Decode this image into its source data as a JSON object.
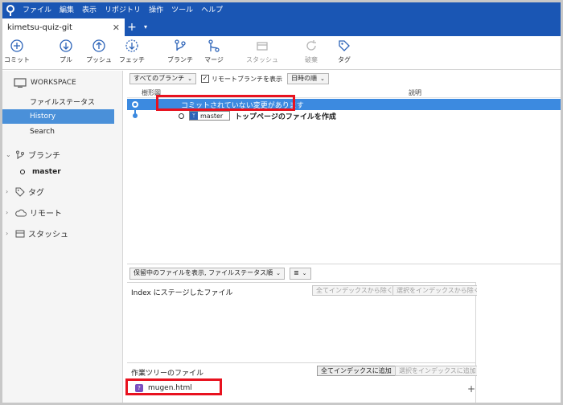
{
  "menu": [
    "ファイル",
    "編集",
    "表示",
    "リポジトリ",
    "操作",
    "ツール",
    "ヘルプ"
  ],
  "tab": {
    "title": "kimetsu-quiz-git",
    "close": "✕",
    "add": "+",
    "menu": "▾"
  },
  "toolbar": {
    "commit": "コミット",
    "pull": "プル",
    "push": "プッシュ",
    "fetch": "フェッチ",
    "branch": "ブランチ",
    "merge": "マージ",
    "stash": "スタッシュ",
    "discard": "破棄",
    "tag": "タグ"
  },
  "sidebar": {
    "workspace": "WORKSPACE",
    "items": [
      "ファイルステータス",
      "History",
      "Search"
    ],
    "selected_index": 1,
    "branches_label": "ブランチ",
    "branch_current": "master",
    "tags_label": "タグ",
    "remotes_label": "リモート",
    "stashes_label": "スタッシュ"
  },
  "filters": {
    "branches": "すべてのブランチ",
    "remote_checkbox_label": "リモートブランチを表示",
    "remote_checked": true,
    "order": "日時の順"
  },
  "columns": {
    "graph": "樹形図",
    "description": "説明"
  },
  "commits": [
    {
      "message": "コミットされていない変更があります",
      "selected": true
    },
    {
      "branch": "master",
      "message": "トップページのファイルを作成",
      "selected": false
    }
  ],
  "lower": {
    "pending_dropdown": "保留中のファイルを表示, ファイルステータス順",
    "list_dropdown": "≣",
    "staged_title": "Index にステージしたファイル",
    "unstage_all": "全てインデックスから除く",
    "unstage_selected": "選択をインデックスから除く",
    "working_title": "作業ツリーのファイル",
    "stage_all": "全てインデックスに追加",
    "stage_selected": "選択をインデックスに追加",
    "file_name": "mugen.html",
    "file_status": "?",
    "plus": "+"
  },
  "colors": {
    "accent": "#1a56b4",
    "selection": "#3c8ae0",
    "highlight": "#e8121f"
  }
}
